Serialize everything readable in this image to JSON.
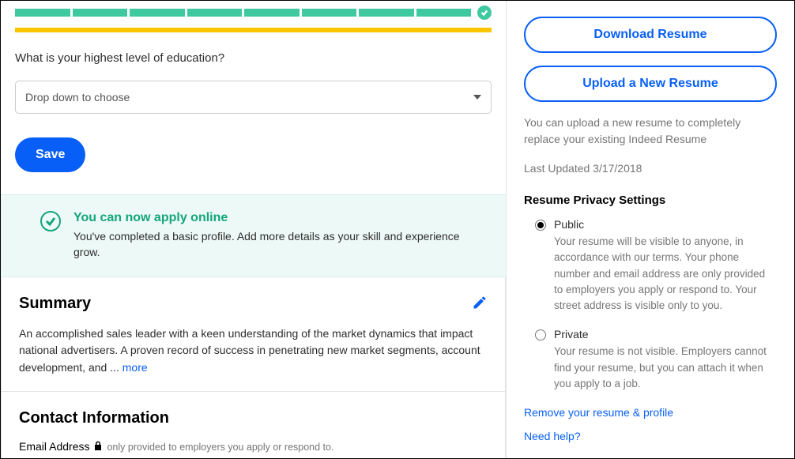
{
  "education": {
    "question": "What is your highest level of education?",
    "placeholder": "Drop down to choose",
    "save_label": "Save"
  },
  "success": {
    "title": "You can now apply online",
    "text": "You've completed a basic profile. Add more details as your skill and experience grow."
  },
  "summary": {
    "heading": "Summary",
    "text": "An accomplished sales leader with a keen understanding of the market dynamics that impact national advertisers. A proven record of success in penetrating new market segments, account development, and ... ",
    "more": "more"
  },
  "contact": {
    "heading": "Contact Information",
    "field_label": "Email Address",
    "hint": "only provided to employers you apply or respond to."
  },
  "side": {
    "download": "Download Resume",
    "upload": "Upload a New Resume",
    "upload_note": "You can upload a new resume to completely replace your existing Indeed Resume",
    "last_updated": "Last Updated 3/17/2018",
    "privacy_heading": "Resume Privacy Settings",
    "public_label": "Public",
    "public_desc": "Your resume will be visible to anyone, in accordance with our terms. Your phone number and email address are only provided to employers you apply or respond to. Your street address is visible only to you.",
    "private_label": "Private",
    "private_desc": "Your resume is not visible. Employers cannot find your resume, but you can attach it when you apply to a job.",
    "remove_link": "Remove your resume & profile",
    "help_link": "Need help?"
  }
}
